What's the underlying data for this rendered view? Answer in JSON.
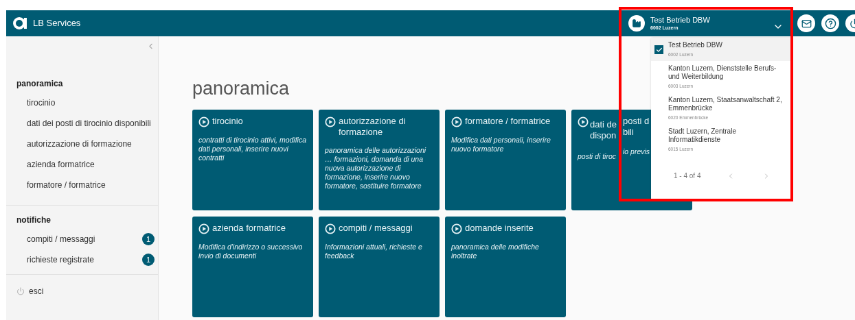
{
  "app": {
    "title": "LB Services"
  },
  "account": {
    "name": "Test Betrieb DBW",
    "address": "6002 Luzern",
    "expanded": true
  },
  "account_menu": {
    "items": [
      {
        "name": "Test Betrieb DBW",
        "address": "6002 Luzern",
        "selected": true
      },
      {
        "name": "Kanton Luzern, Dienststelle Berufs- und Weiterbildung",
        "address": "6003 Luzern",
        "selected": false
      },
      {
        "name": "Kanton Luzern, Staatsanwaltschaft 2, Emmenbrücke",
        "address": "6020 Emmenbrücke",
        "selected": false
      },
      {
        "name": "Stadt Luzern, Zentrale Informatikdienste",
        "address": "6015 Luzern",
        "selected": false
      }
    ],
    "pagination": "1 - 4 of 4"
  },
  "sidebar": {
    "sections": [
      {
        "title": "panoramica",
        "items": [
          {
            "label": "tirocinio"
          },
          {
            "label": "dati dei posti di tirocinio disponibili"
          },
          {
            "label": "autorizzazione di formazione"
          },
          {
            "label": "azienda formatrice"
          },
          {
            "label": "formatore / formatrice"
          }
        ]
      },
      {
        "title": "notifiche",
        "items": [
          {
            "label": "compiti / messaggi",
            "badge": "1"
          },
          {
            "label": "richieste registrate",
            "badge": "1"
          }
        ]
      }
    ],
    "logout": "esci"
  },
  "page_title": "panoramica",
  "cards": [
    {
      "kind": "full",
      "title": "tirocinio",
      "description": "contratti di tirocinio attivi, modifica dati personali, inserire nuovi contratti"
    },
    {
      "kind": "full",
      "title": "autorizzazione di formazione",
      "description": "panoramica delle autorizzazioni … formazioni, domanda di una nuova autorizzazione di formazione, inserire nuovo formatore, sostituire formatore"
    },
    {
      "kind": "full",
      "title": "formatore / formatrice",
      "description": "Modifica dati personali, inserire nuovo formatore"
    },
    {
      "kind": "covered",
      "title_lines": [
        [
          "dati de",
          "posti d"
        ],
        [
          "dispon",
          "bili"
        ]
      ],
      "description_parts": [
        "posti di tiroc",
        "io previs"
      ]
    },
    {
      "kind": "full",
      "title": "azienda formatrice",
      "description": "Modifica d'indirizzo o successivo invio di documenti"
    },
    {
      "kind": "full",
      "title": "compiti / messaggi",
      "description": "Informazioni attuali, richieste e feedback"
    },
    {
      "kind": "full",
      "title": "domande inserite",
      "description": "panoramica delle modifiche inoltrate"
    }
  ]
}
